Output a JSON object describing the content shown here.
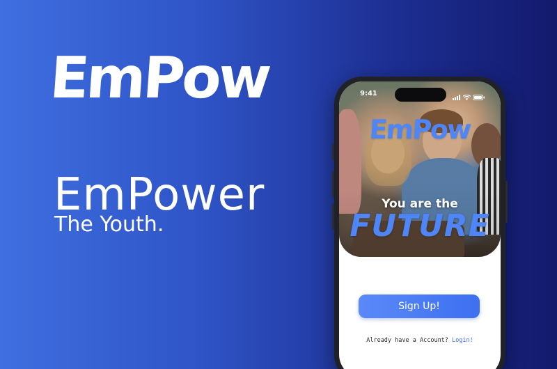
{
  "brand": {
    "logo_text": "EmPow",
    "headline": "EmPower",
    "subheadline": "The Youth."
  },
  "phone": {
    "status_bar": {
      "time": "9:41",
      "icons": [
        "signal-icon",
        "wifi-icon",
        "battery-icon"
      ]
    },
    "hero": {
      "logo_text": "EmPow",
      "tagline": "You are the",
      "tagline_emphasis": "FUTURE"
    },
    "signup_label": "Sign Up!",
    "account_prompt": "Already have a Account?",
    "login_label": "Login!"
  },
  "colors": {
    "background_left": "#3f6fe0",
    "background_right": "#121a6c",
    "accent": "#4f86f7",
    "button": "#4a7cf4",
    "link": "#3f74f0"
  }
}
